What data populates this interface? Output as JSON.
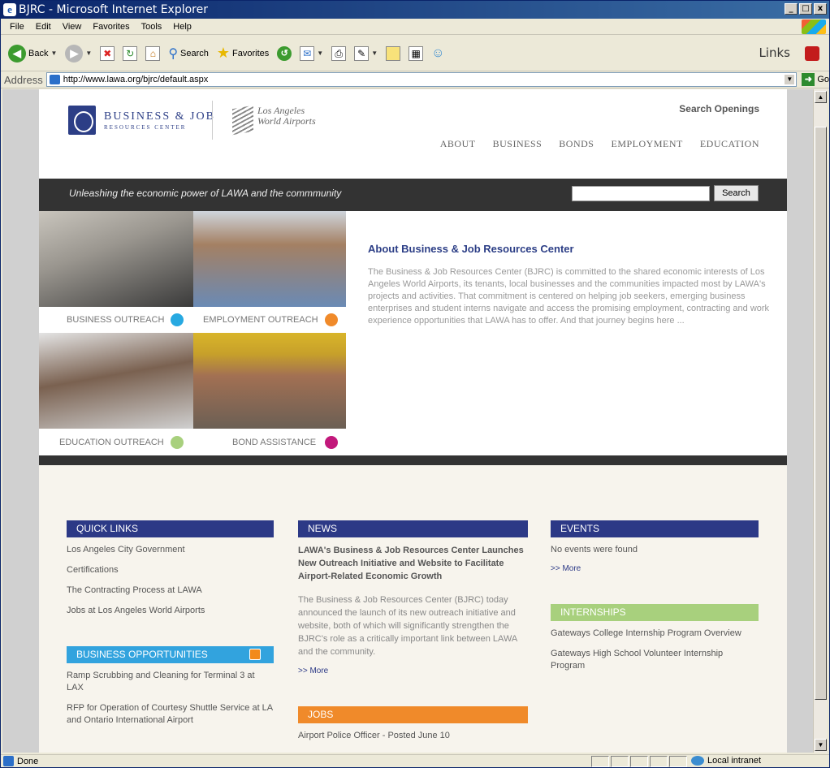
{
  "window": {
    "title": "BJRC - Microsoft Internet Explorer",
    "minimize": "_",
    "maximize": "□",
    "close": "x"
  },
  "menu": [
    "File",
    "Edit",
    "View",
    "Favorites",
    "Tools",
    "Help"
  ],
  "toolbar": {
    "back": "Back",
    "search": "Search",
    "favorites": "Favorites",
    "links": "Links"
  },
  "address": {
    "label": "Address",
    "url": "http://www.lawa.org/bjrc/default.aspx",
    "go": "Go"
  },
  "header": {
    "logo_line1": "BUSINESS & JOB",
    "logo_line2": "RESOURCES CENTER",
    "lawa_line1": "Los Angeles",
    "lawa_line2": "World Airports",
    "search_openings": "Search Openings",
    "nav": [
      "ABOUT",
      "BUSINESS",
      "BONDS",
      "EMPLOYMENT",
      "EDUCATION"
    ]
  },
  "banner": {
    "tagline": "Unleashing the economic power of LAWA and the commmunity",
    "search_button": "Search"
  },
  "tiles": [
    {
      "label": "BUSINESS OUTREACH",
      "color": "#27a9e1"
    },
    {
      "label": "EMPLOYMENT OUTREACH",
      "color": "#f08a2a"
    },
    {
      "label": "EDUCATION OUTREACH",
      "color": "#a8d07d"
    },
    {
      "label": "BOND ASSISTANCE",
      "color": "#c2187b"
    }
  ],
  "about": {
    "title": "About Business & Job Resources Center",
    "body": "The Business & Job Resources Center (BJRC) is committed to the shared economic interests of Los Angeles World Airports, its tenants, local businesses and the communities impacted most by LAWA's projects and activities. That commitment is centered on helping job seekers, emerging business enterprises and student interns navigate and access the promising employment, contracting and work experience opportunities that LAWA has to offer. And that journey begins here ..."
  },
  "quick_links": {
    "title": "QUICK LINKS",
    "items": [
      "Los Angeles City Government",
      "Certifications",
      "The Contracting Process at LAWA",
      "Jobs at Los Angeles World Airports"
    ]
  },
  "business_opportunities": {
    "title": "BUSINESS OPPORTUNITIES",
    "items": [
      "Ramp Scrubbing and Cleaning for Terminal 3 at LAX",
      "RFP for Operation of Courtesy Shuttle Service at LA and Ontario International Airport"
    ]
  },
  "news": {
    "title": "NEWS",
    "headline": "LAWA's Business & Job Resources Center Launches New Outreach Initiative and Website to Facilitate Airport-Related Economic Growth",
    "body": "The Business & Job Resources Center (BJRC) today announced the launch of its new outreach initiative and website, both of which will significantly strengthen the BJRC's role as a critically important link between LAWA and the community.",
    "more": ">> More"
  },
  "jobs": {
    "title": "JOBS",
    "items": [
      "Airport Police Officer - Posted June 10"
    ]
  },
  "events": {
    "title": "EVENTS",
    "empty": "No events were found",
    "more": ">> More"
  },
  "internships": {
    "title": "INTERNSHIPS",
    "items": [
      "Gateways College Internship Program Overview",
      "Gateways High School Volunteer Internship Program"
    ]
  },
  "status": {
    "text": "Done",
    "zone": "Local intranet"
  }
}
